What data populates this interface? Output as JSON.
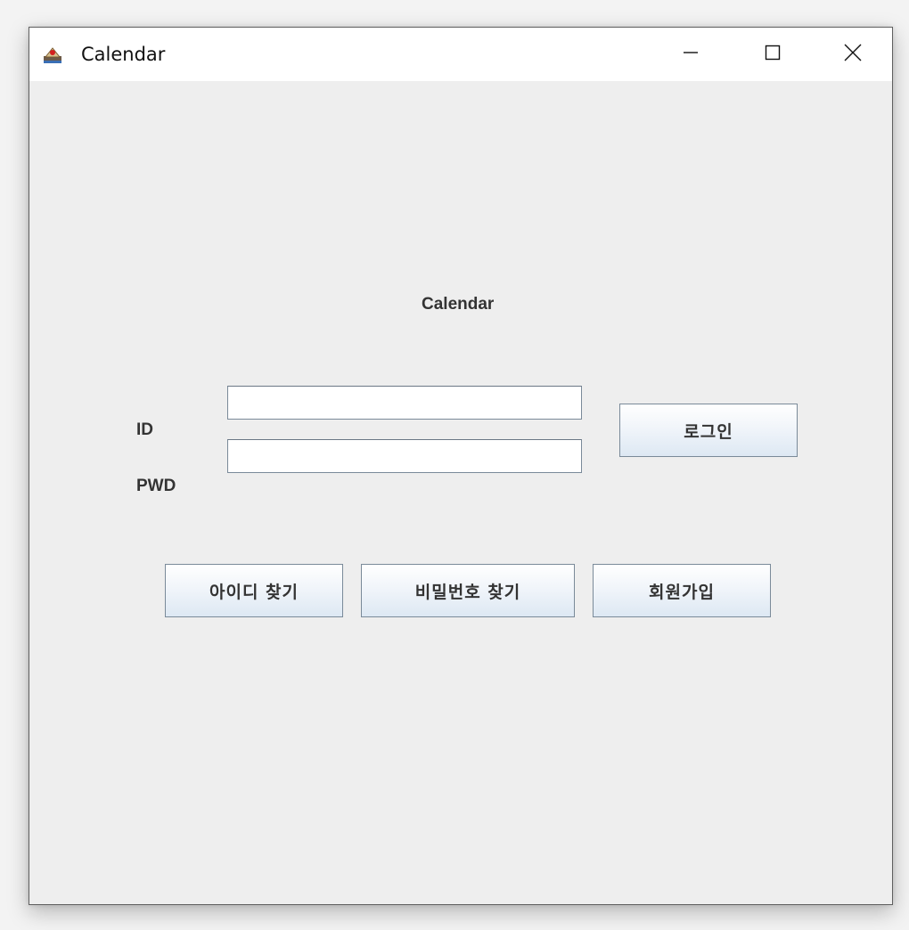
{
  "window": {
    "title": "Calendar",
    "icon": "java-app-icon",
    "controls": {
      "minimize": "minimize-icon",
      "maximize": "maximize-icon",
      "close": "close-icon"
    }
  },
  "form": {
    "heading": "Calendar",
    "id_label": "ID",
    "id_value": "",
    "pwd_label": "PWD",
    "pwd_value": "",
    "login_label": "로그인"
  },
  "actions": {
    "find_id_label": "아이디 찾기",
    "find_password_label": "비밀번호 찾기",
    "signup_label": "회원가입"
  },
  "colors": {
    "window_background": "#eeeeee",
    "titlebar_background": "#ffffff",
    "button_gradient_top": "#ffffff",
    "button_gradient_bottom": "#dde8f3",
    "button_border": "#7a8a99"
  }
}
